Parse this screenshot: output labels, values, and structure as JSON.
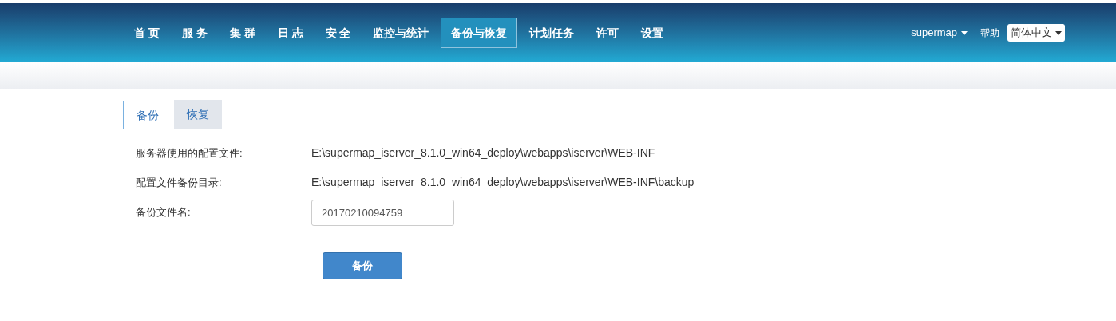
{
  "nav": {
    "items": [
      {
        "label": "首 页",
        "selected": false
      },
      {
        "label": "服 务",
        "selected": false
      },
      {
        "label": "集 群",
        "selected": false
      },
      {
        "label": "日 志",
        "selected": false
      },
      {
        "label": "安 全",
        "selected": false
      },
      {
        "label": "监控与统计",
        "selected": false
      },
      {
        "label": "备份与恢复",
        "selected": true
      },
      {
        "label": "计划任务",
        "selected": false
      },
      {
        "label": "许可",
        "selected": false
      },
      {
        "label": "设置",
        "selected": false
      }
    ],
    "user": "supermap",
    "help": "帮助",
    "language": "简体中文"
  },
  "tabs": [
    {
      "label": "备份",
      "selected": true
    },
    {
      "label": "恢复",
      "selected": false
    }
  ],
  "form": {
    "rows": [
      {
        "kind": "text",
        "label": "服务器使用的配置文件:",
        "value": "E:\\supermap_iserver_8.1.0_win64_deploy\\webapps\\iserver\\WEB-INF"
      },
      {
        "kind": "text",
        "label": "配置文件备份目录:",
        "value": "E:\\supermap_iserver_8.1.0_win64_deploy\\webapps\\iserver\\WEB-INF\\backup"
      },
      {
        "kind": "input",
        "label": "备份文件名:",
        "value": "20170210094759"
      }
    ],
    "submit": "备份"
  }
}
